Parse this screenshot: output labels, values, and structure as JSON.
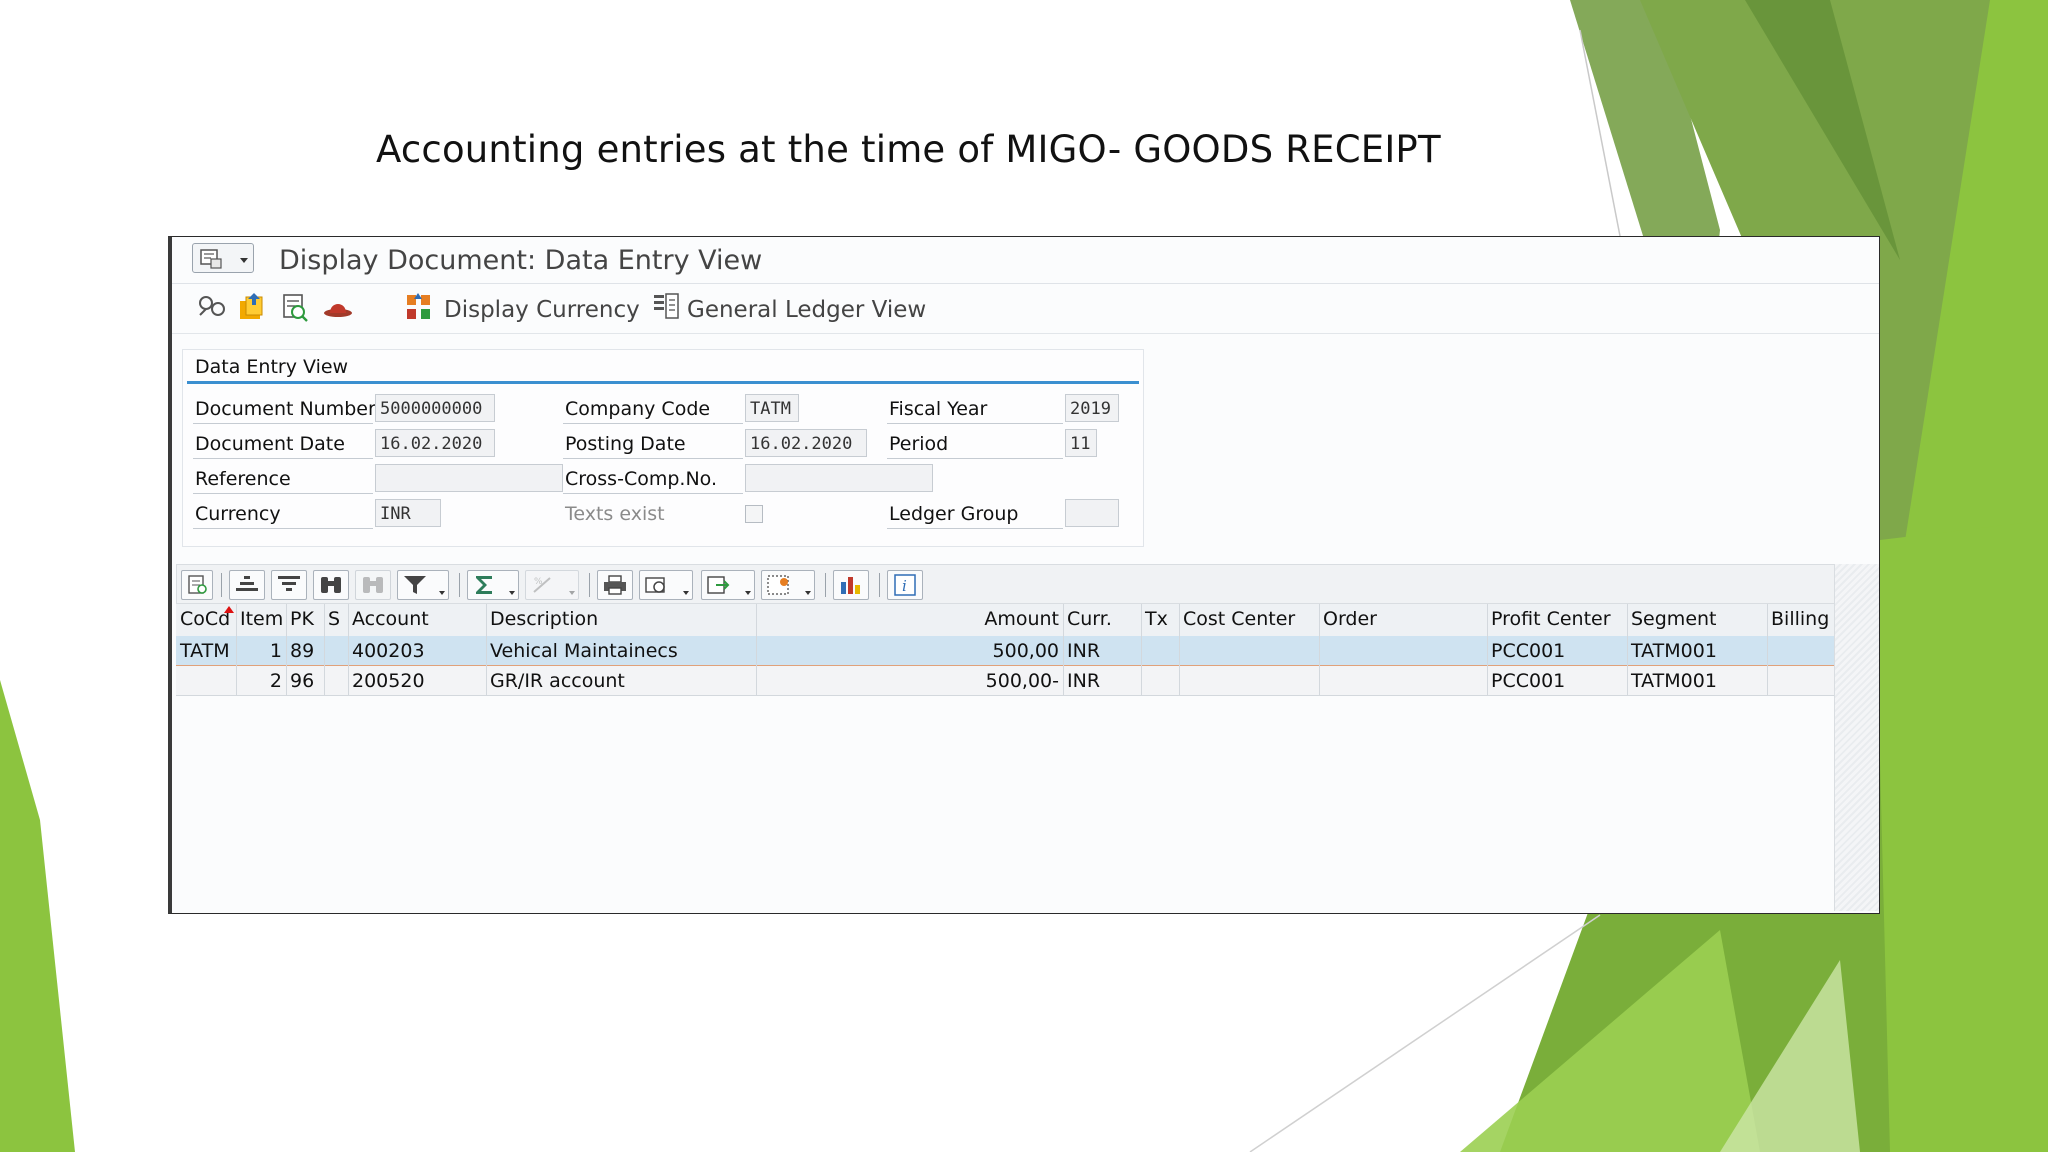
{
  "slide": {
    "title": "Accounting entries at the time of MIGO- GOODS RECEIPT"
  },
  "window": {
    "title": "Display Document: Data Entry View",
    "menu_icon": "document-menu-icon"
  },
  "toolbar": {
    "icons": [
      "display-glasses-icon",
      "change-document-icon",
      "document-overview-icon",
      "hat-icon",
      "display-currency-icon",
      "general-ledger-icon"
    ],
    "display_currency_label": "Display Currency",
    "general_ledger_label": "General Ledger View"
  },
  "header": {
    "panel_title": "Data Entry View",
    "document_number_label": "Document Number",
    "document_number": "5000000000",
    "company_code_label": "Company Code",
    "company_code": "TATM",
    "fiscal_year_label": "Fiscal Year",
    "fiscal_year": "2019",
    "document_date_label": "Document Date",
    "document_date": "16.02.2020",
    "posting_date_label": "Posting Date",
    "posting_date": "16.02.2020",
    "period_label": "Period",
    "period": "11",
    "reference_label": "Reference",
    "reference": "",
    "cross_comp_label": "Cross-Comp.No.",
    "cross_comp": "",
    "currency_label": "Currency",
    "currency": "INR",
    "texts_exist_label": "Texts exist",
    "ledger_group_label": "Ledger Group",
    "ledger_group": ""
  },
  "grid": {
    "columns": {
      "cocd": "CoCd",
      "item": "Item",
      "pk": "PK",
      "s": "S",
      "account": "Account",
      "description": "Description",
      "amount": "Amount",
      "curr": "Curr.",
      "tx": "Tx",
      "cost_center": "Cost Center",
      "order": "Order",
      "profit_center": "Profit Center",
      "segment": "Segment",
      "billing": "Billing"
    },
    "rows": [
      {
        "cocd": "TATM",
        "item": "1",
        "pk": "89",
        "s": "",
        "account": "400203",
        "description": "Vehical Maintainecs",
        "amount": "500,00",
        "curr": "INR",
        "tx": "",
        "cost_center": "",
        "order": "",
        "profit_center": "PCC001",
        "segment": "TATM001",
        "billing": ""
      },
      {
        "cocd": "",
        "item": "2",
        "pk": "96",
        "s": "",
        "account": "200520",
        "description": "GR/IR account",
        "amount": "500,00-",
        "curr": "INR",
        "tx": "",
        "cost_center": "",
        "order": "",
        "profit_center": "PCC001",
        "segment": "TATM001",
        "billing": ""
      }
    ]
  },
  "colors": {
    "slide_green_dark": "#6e9a3c",
    "slide_green_light": "#8dc63f",
    "selection_blue": "#cfe3f1",
    "row_border_orange": "#e0a17a",
    "panel_underline": "#3b8fd0"
  }
}
